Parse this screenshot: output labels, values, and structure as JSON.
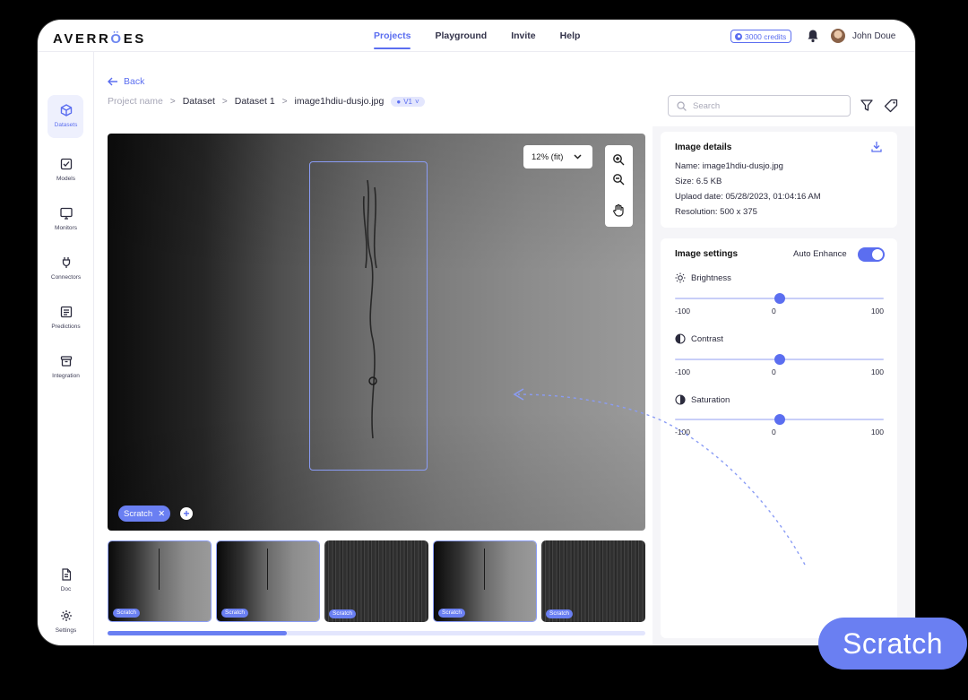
{
  "header": {
    "logo": {
      "pre": "AVERR",
      "mark": "Ö",
      "post": "ES"
    },
    "nav": [
      "Projects",
      "Playground",
      "Invite",
      "Help"
    ],
    "active_nav": "Projects",
    "credits": "3000 credits",
    "user_name": "John Doue"
  },
  "sidebar": {
    "items": [
      {
        "label": "Datasets",
        "icon": "cube-icon"
      },
      {
        "label": "Models",
        "icon": "checkbox-icon"
      },
      {
        "label": "Monitors",
        "icon": "monitor-icon"
      },
      {
        "label": "Connectors",
        "icon": "plug-icon"
      },
      {
        "label": "Predictions",
        "icon": "list-icon"
      },
      {
        "label": "Integration",
        "icon": "box-icon"
      }
    ],
    "bottom": [
      {
        "label": "Doc",
        "icon": "document-icon"
      },
      {
        "label": "Settings",
        "icon": "gear-icon"
      }
    ]
  },
  "breadcrumb": {
    "back": "Back",
    "items": [
      "Project name",
      "Dataset",
      "Dataset 1",
      "image1hdiu-dusjo.jpg"
    ],
    "version": "V1"
  },
  "viewer": {
    "zoom": "12% (fit)",
    "tag": "Scratch"
  },
  "thumbnails": [
    {
      "label": "Scratch",
      "selected": true
    },
    {
      "label": "Scratch",
      "selected": true
    },
    {
      "label": "Scratch",
      "selected": false
    },
    {
      "label": "Scratch",
      "selected": true
    },
    {
      "label": "Scratch",
      "selected": false
    }
  ],
  "search": {
    "placeholder": "Search"
  },
  "details": {
    "title": "Image details",
    "name_label": "Name:",
    "name": "image1hdiu-dusjo.jpg",
    "size_label": "Size:",
    "size": "6.5 KB",
    "date_label": "Uplaod date:",
    "date": "05/28/2023, 01:04:16 AM",
    "res_label": "Resolution:",
    "resolution": "500 x 375"
  },
  "settings": {
    "title": "Image settings",
    "auto_enhance": "Auto Enhance",
    "auto_enhance_on": true,
    "sliders": [
      {
        "label": "Brightness",
        "min": "-100",
        "mid": "0",
        "max": "100",
        "value": 0
      },
      {
        "label": "Contrast",
        "min": "-100",
        "mid": "0",
        "max": "100",
        "value": 0
      },
      {
        "label": "Saturation",
        "min": "-100",
        "mid": "0",
        "max": "100",
        "value": 0
      }
    ]
  },
  "callout": "Scratch",
  "colors": {
    "accent": "#5b6ef0",
    "chip": "#6a7ff2",
    "box": "#8a9cf5"
  }
}
